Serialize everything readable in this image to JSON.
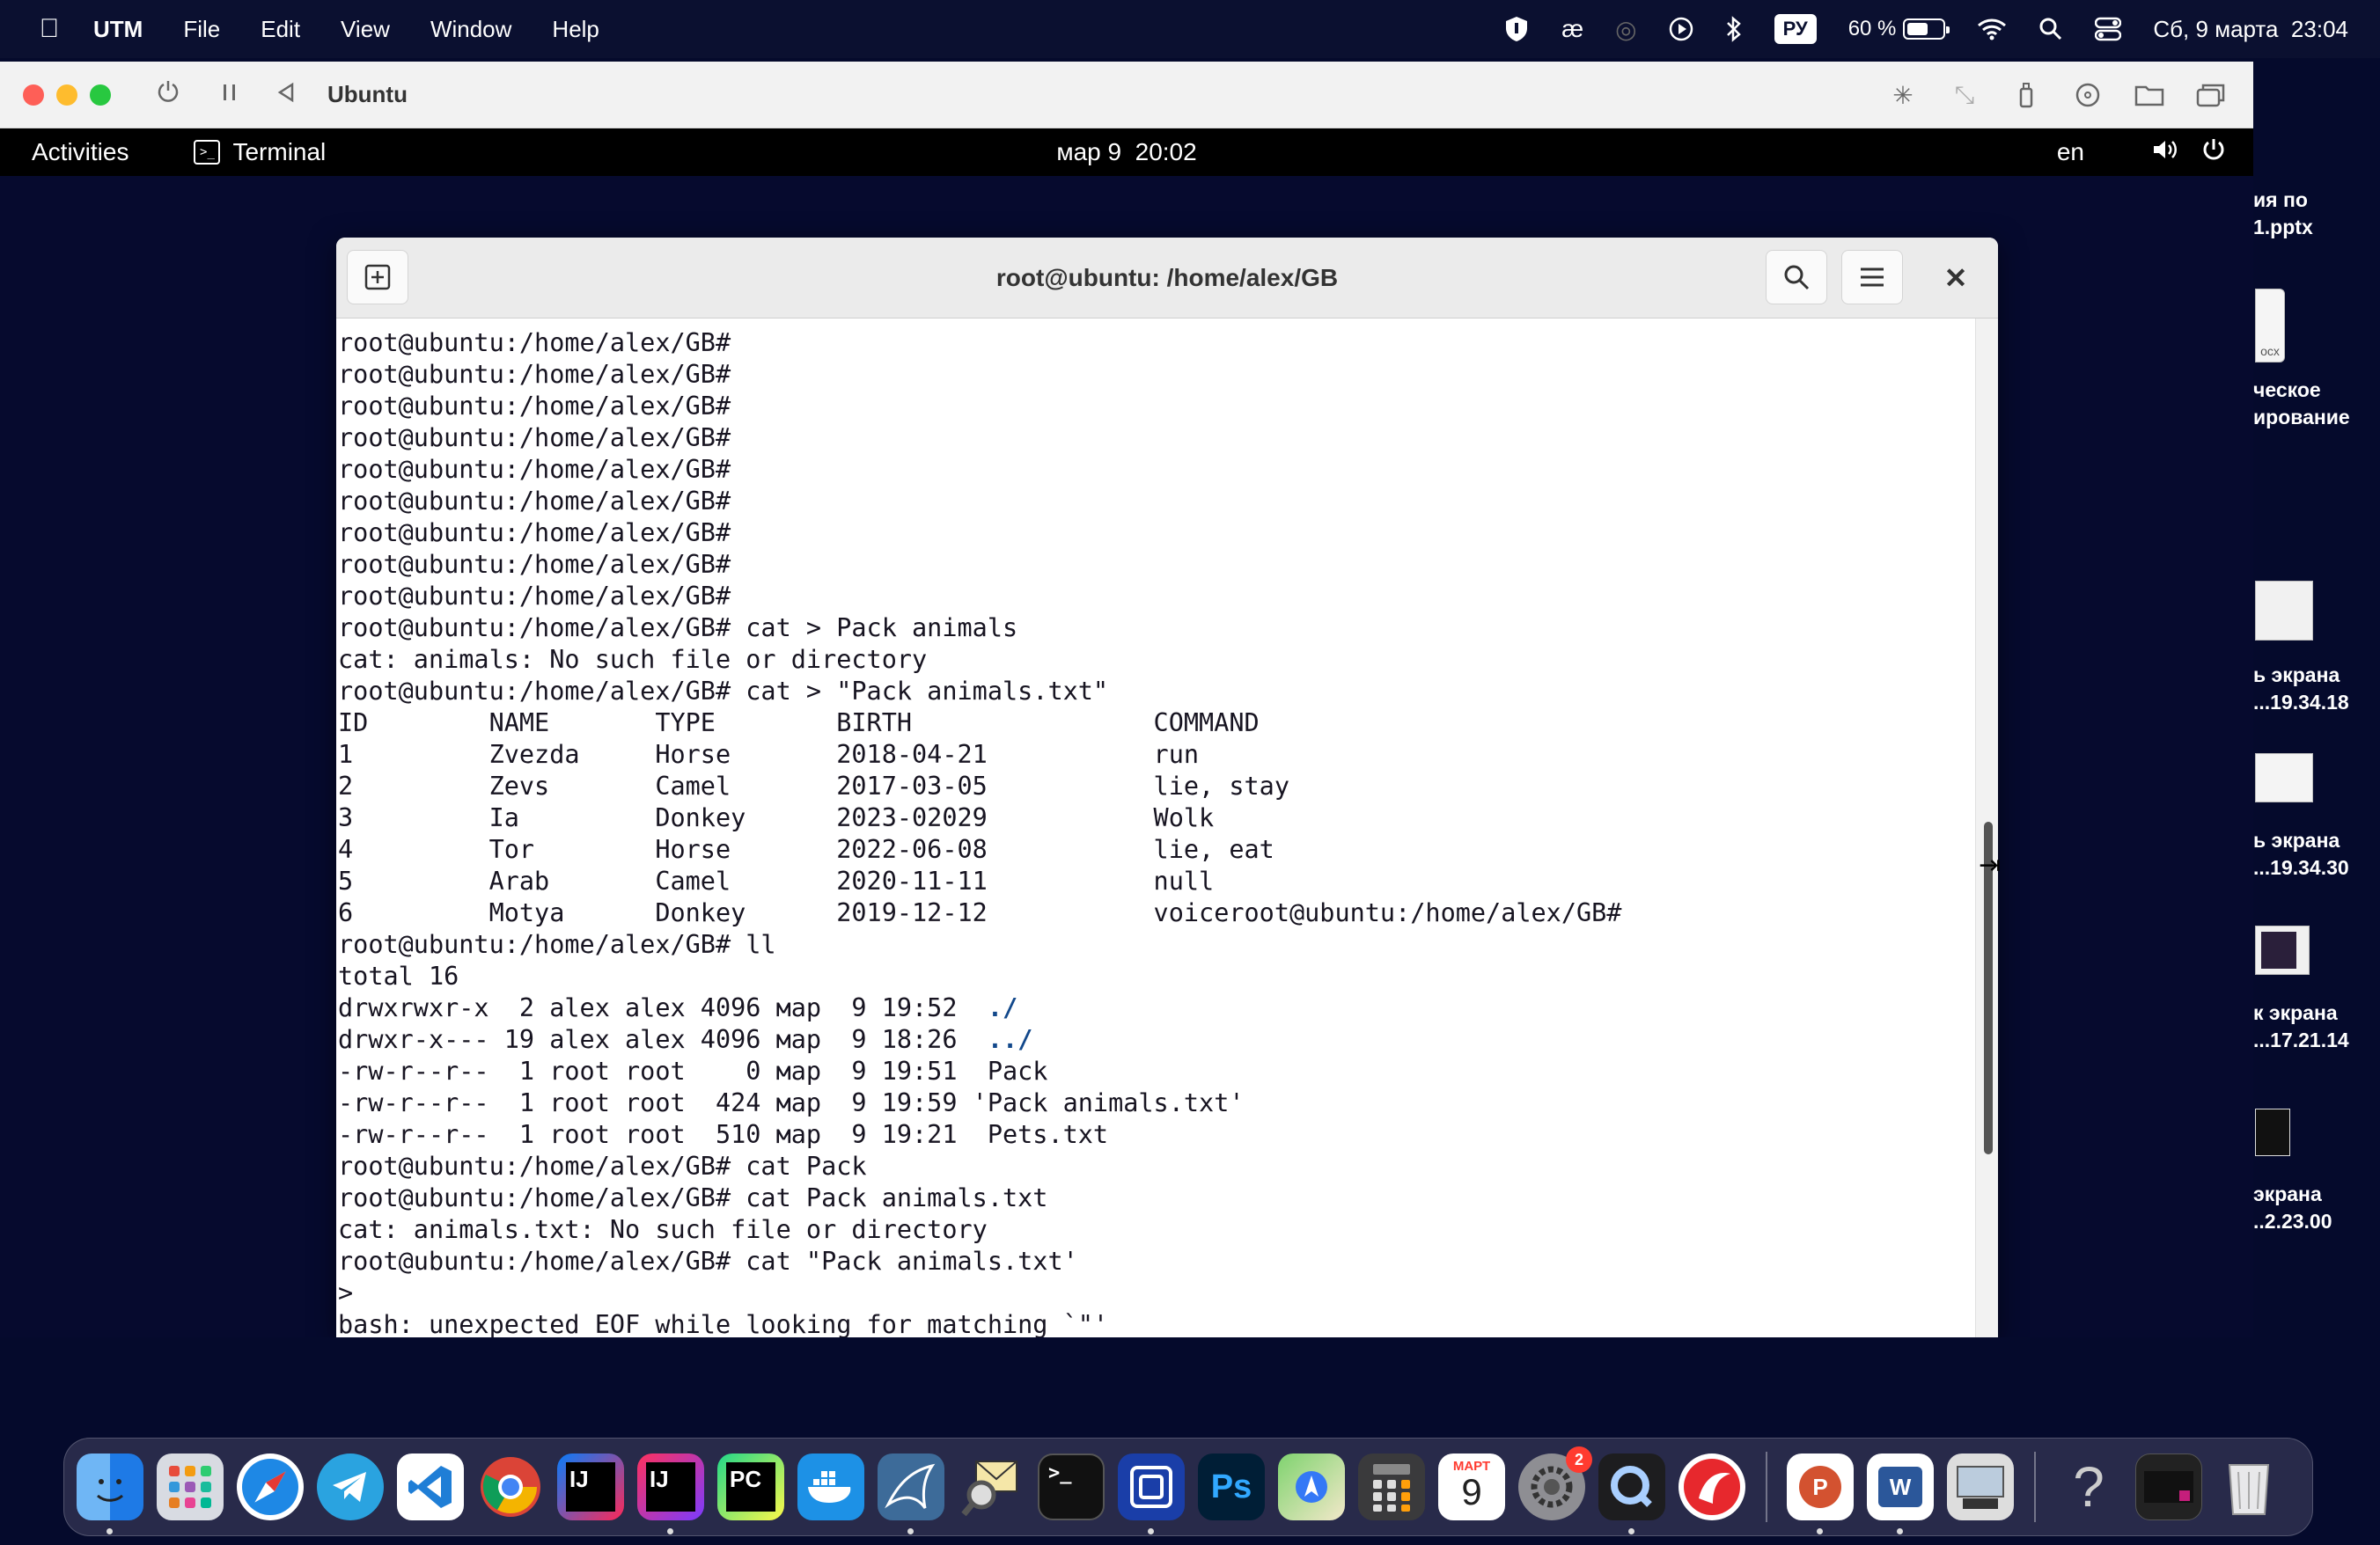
{
  "menubar": {
    "app_name": "UTM",
    "items": [
      "File",
      "Edit",
      "View",
      "Window",
      "Help"
    ],
    "input_source": "РУ",
    "battery_percent": "60 %",
    "battery_level": 0.6,
    "datetime": "Сб, 9 марта  23:04",
    "icons": [
      "shield-icon",
      "ae-icon",
      "airdrop-icon",
      "play-circle-icon",
      "bluetooth-icon",
      "wifi-icon",
      "spotlight-icon",
      "control-center-icon"
    ]
  },
  "utm": {
    "title": "Ubuntu",
    "toolbar_icons": [
      "power-icon",
      "pause-icon",
      "back-icon",
      "capture-cursor-icon",
      "resize-icon",
      "usb-icon",
      "cd-icon",
      "shared-folder-icon",
      "windows-icon"
    ]
  },
  "gnome": {
    "activities": "Activities",
    "app_name": "Terminal",
    "clock": "мар 9  20:02",
    "lang": "en"
  },
  "terminal": {
    "title": "root@ubuntu: /home/alex/GB",
    "lines": [
      "root@ubuntu:/home/alex/GB#",
      "root@ubuntu:/home/alex/GB#",
      "root@ubuntu:/home/alex/GB#",
      "root@ubuntu:/home/alex/GB#",
      "root@ubuntu:/home/alex/GB#",
      "root@ubuntu:/home/alex/GB#",
      "root@ubuntu:/home/alex/GB#",
      "root@ubuntu:/home/alex/GB#",
      "root@ubuntu:/home/alex/GB#",
      "root@ubuntu:/home/alex/GB# cat > Pack animals",
      "cat: animals: No such file or directory",
      "root@ubuntu:/home/alex/GB# cat > \"Pack animals.txt\"",
      "ID        NAME       TYPE        BIRTH                COMMAND",
      "1         Zvezda     Horse       2018-04-21           run",
      "2         Zevs       Camel       2017-03-05           lie, stay",
      "3         Ia         Donkey      2023-02029           Wolk",
      "4         Tor        Horse       2022-06-08           lie, eat",
      "5         Arab       Camel       2020-11-11           null",
      "6         Motya      Donkey      2019-12-12           voiceroot@ubuntu:/home/alex/GB#",
      "root@ubuntu:/home/alex/GB# ll",
      "total 16",
      "drwxrwxr-x  2 alex alex 4096 мар  9 19:52  ",
      "drwxr-x--- 19 alex alex 4096 мар  9 18:26  ",
      "-rw-r--r--  1 root root    0 мар  9 19:51  Pack",
      "-rw-r--r--  1 root root  424 мар  9 19:59 'Pack animals.txt'",
      "-rw-r--r--  1 root root  510 мар  9 19:21  Pets.txt",
      "root@ubuntu:/home/alex/GB# cat Pack",
      "root@ubuntu:/home/alex/GB# cat Pack animals.txt",
      "cat: animals.txt: No such file or directory",
      "root@ubuntu:/home/alex/GB# cat \"Pack animals.txt'",
      ">",
      "bash: unexpected EOF while looking for matching `\"'"
    ],
    "dir_entries": [
      "./",
      "../"
    ]
  },
  "debian_logo": "debian",
  "desktop_files": [
    {
      "line1": "ия по",
      "line2": "1.pptx"
    },
    {
      "line1": "ческое",
      "line2": "ирование"
    },
    {
      "line1": "ь экрана",
      "line2": "...19.34.18"
    },
    {
      "line1": "ь экрана",
      "line2": "...19.34.30"
    },
    {
      "line1": "к экрана",
      "line2": "...17.21.14"
    },
    {
      "line1": "экрана",
      "line2": "..2.23.00"
    }
  ],
  "desktop_doc_label": "ocx",
  "dock": {
    "apps": [
      "finder",
      "launchpad",
      "safari",
      "telegram",
      "vscode",
      "chrome",
      "intellij-ce",
      "intellij",
      "pycharm",
      "docker",
      "mysql-workbench",
      "mail-search",
      "terminal",
      "utm-like",
      "photoshop",
      "maps",
      "calculator",
      "calendar",
      "system-settings",
      "quicktime",
      "opera"
    ],
    "pycharm_label": "PC",
    "intellij_label": "IJ",
    "photoshop_label": "Ps",
    "calendar_month": "МАРТ",
    "calendar_day": "9",
    "settings_badge": "2",
    "powerpoint_label": "P",
    "word_label": "W"
  }
}
